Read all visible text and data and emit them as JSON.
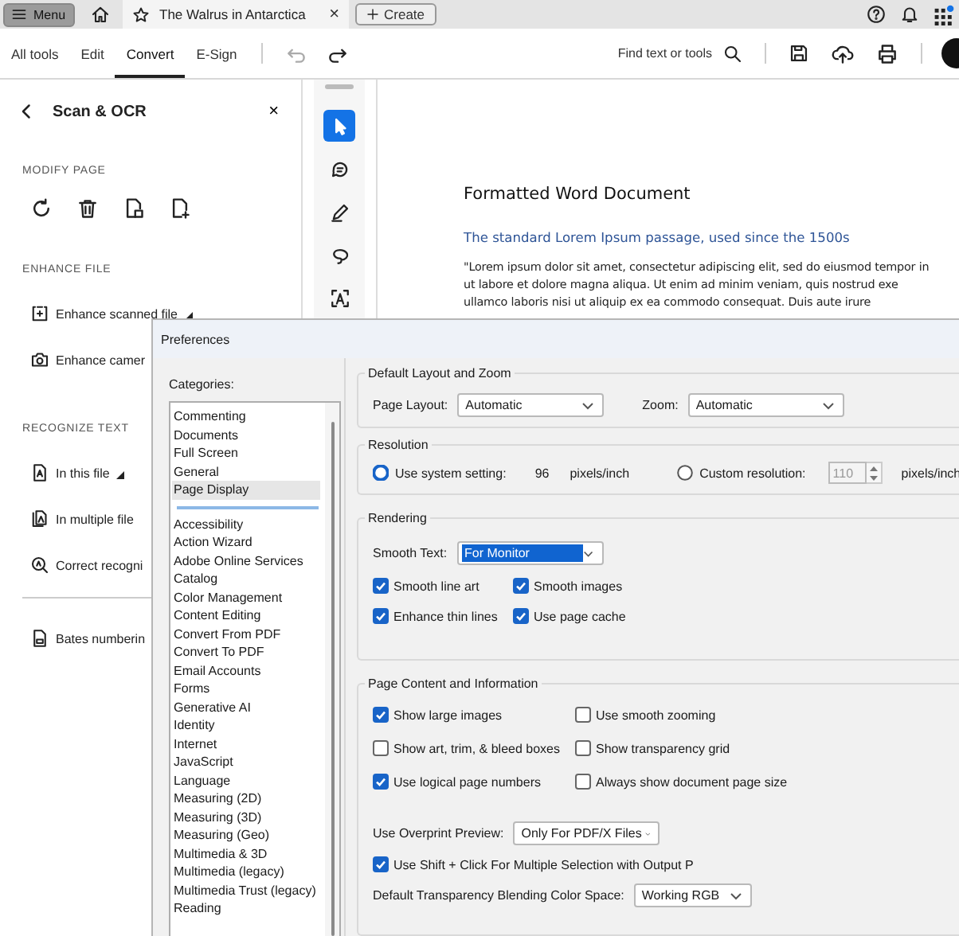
{
  "top_bar": {
    "menu_button": "Menu",
    "tab": {
      "title": "The Walrus in Antarctica",
      "close": "×"
    },
    "create_button": "Create"
  },
  "toolbar": {
    "tabs": [
      {
        "label": "All tools",
        "selected": false
      },
      {
        "label": "Edit",
        "selected": false
      },
      {
        "label": "Convert",
        "selected": true
      },
      {
        "label": "E-Sign",
        "selected": false
      }
    ],
    "history": [
      {
        "kind": "undo",
        "disabled": true
      },
      {
        "kind": "redo",
        "disabled": false
      }
    ],
    "search": "Find text or tools"
  },
  "panel": {
    "title": "Scan & OCR",
    "close": "×",
    "sections": [
      {
        "heading": "MODIFY PAGE",
        "kind": "icons"
      },
      {
        "heading": "ENHANCE FILE",
        "kind": "items",
        "items": [
          {
            "kind": "scan",
            "label": "Enhance scanned file",
            "has_menu": true
          },
          {
            "kind": "camera",
            "label": "Enhance camer",
            "has_menu": false
          }
        ]
      },
      {
        "heading": "RECOGNIZE TEXT",
        "kind": "items",
        "items": [
          {
            "kind": "page-text",
            "label": "In this file",
            "has_menu": true
          },
          {
            "kind": "pages-text",
            "label": "In multiple file",
            "has_menu": false
          },
          {
            "kind": "search-text",
            "label": "Correct recogni",
            "has_menu": false
          }
        ]
      },
      {
        "kind": "items",
        "items": [
          {
            "kind": "bates",
            "label": "Bates numberin",
            "has_menu": false
          }
        ]
      }
    ]
  },
  "tool_rail": [
    {
      "kind": "select",
      "selected": true
    },
    {
      "kind": "comment",
      "selected": false
    },
    {
      "kind": "pen",
      "selected": false
    },
    {
      "kind": "lasso",
      "selected": false
    },
    {
      "kind": "text-box",
      "selected": false
    }
  ],
  "document": {
    "title": "Formatted Word Document",
    "heading": "The standard Lorem Ipsum passage, used since the 1500s",
    "lines": [
      "\"Lorem ipsum dolor sit amet, consectetur adipiscing elit, sed do eiusmod tempor in",
      "ut labore et dolore magna aliqua. Ut enim ad minim veniam, quis nostrud exe",
      "ullamco laboris nisi ut aliquip ex ea commodo consequat. Duis aute irure"
    ]
  },
  "dialog": {
    "title": "Preferences",
    "categories_label": "Categories:",
    "pinned": [
      {
        "label": "Commenting",
        "selected": false
      },
      {
        "label": "Documents",
        "selected": false
      },
      {
        "label": "Full Screen",
        "selected": false
      },
      {
        "label": "General",
        "selected": false
      },
      {
        "label": "Page Display",
        "selected": true
      }
    ],
    "categories": [
      {
        "label": "Accessibility",
        "selected": false
      },
      {
        "label": "Action Wizard",
        "selected": false
      },
      {
        "label": "Adobe Online Services",
        "selected": false
      },
      {
        "label": "Catalog",
        "selected": false
      },
      {
        "label": "Color Management",
        "selected": false
      },
      {
        "label": "Content Editing",
        "selected": false
      },
      {
        "label": "Convert From PDF",
        "selected": false
      },
      {
        "label": "Convert To PDF",
        "selected": false
      },
      {
        "label": "Email Accounts",
        "selected": false
      },
      {
        "label": "Forms",
        "selected": false
      },
      {
        "label": "Generative AI",
        "selected": false
      },
      {
        "label": "Identity",
        "selected": false
      },
      {
        "label": "Internet",
        "selected": false
      },
      {
        "label": "JavaScript",
        "selected": false
      },
      {
        "label": "Language",
        "selected": false
      },
      {
        "label": "Measuring (2D)",
        "selected": false
      },
      {
        "label": "Measuring (3D)",
        "selected": false
      },
      {
        "label": "Measuring (Geo)",
        "selected": false
      },
      {
        "label": "Multimedia & 3D",
        "selected": false
      },
      {
        "label": "Multimedia (legacy)",
        "selected": false
      },
      {
        "label": "Multimedia Trust (legacy)",
        "selected": false
      },
      {
        "label": "Reading",
        "selected": false
      }
    ],
    "layout_zoom": {
      "title": "Default Layout and Zoom",
      "page_layout": {
        "label": "Page Layout:",
        "value": "Automatic"
      },
      "zoom": {
        "label": "Zoom:",
        "value": "Automatic"
      }
    },
    "resolution": {
      "title": "Resolution",
      "options": [
        {
          "label": "Use system setting:",
          "selected": true,
          "value": "96",
          "unit": "pixels/inch"
        },
        {
          "label": "Custom resolution:",
          "selected": false,
          "value": "110",
          "unit": "pixels/inch"
        }
      ]
    },
    "rendering": {
      "title": "Rendering",
      "smooth_text": {
        "label": "Smooth Text:",
        "value": "For Monitor"
      },
      "checkboxes": [
        {
          "label": "Smooth line art",
          "checked": true
        },
        {
          "label": "Smooth images",
          "checked": true
        },
        {
          "label": "Enhance thin lines",
          "checked": true
        },
        {
          "label": "Use page cache",
          "checked": true
        }
      ]
    },
    "page_content": {
      "title": "Page Content and Information",
      "checkboxes": [
        {
          "label": "Show large images",
          "checked": true
        },
        {
          "label": "Use smooth zooming",
          "checked": false
        },
        {
          "label": "Show art, trim, & bleed boxes",
          "checked": false
        },
        {
          "label": "Show transparency grid",
          "checked": false
        },
        {
          "label": "Use logical page numbers",
          "checked": true
        },
        {
          "label": "Always show document page size",
          "checked": false
        }
      ],
      "overprint": {
        "label": "Use Overprint Preview:",
        "value": "Only For PDF/X Files"
      },
      "shift_click": {
        "label": "Use Shift + Click For Multiple Selection with Output P",
        "checked": true
      },
      "blending": {
        "label": "Default Transparency Blending Color Space:",
        "value": "Working RGB"
      }
    }
  }
}
